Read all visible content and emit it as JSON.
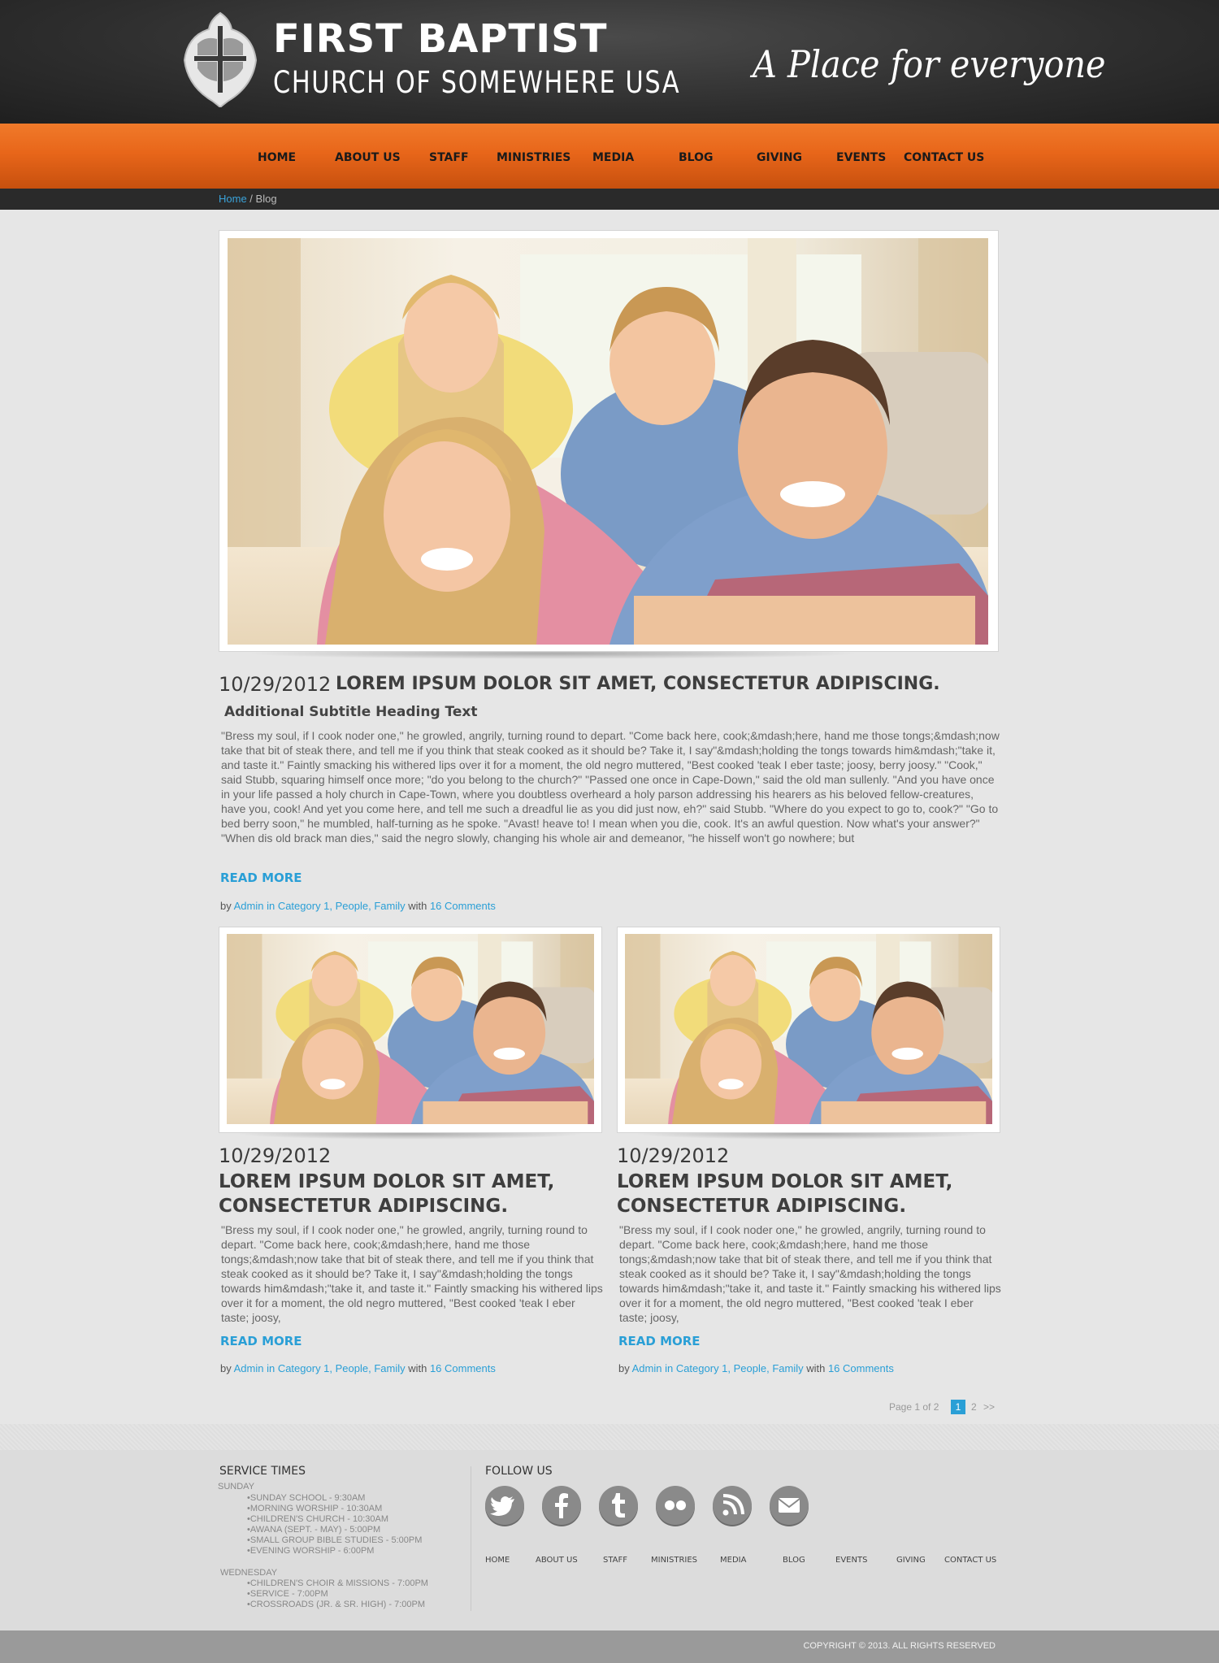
{
  "header": {
    "brand_line1": "FIRST BAPTIST",
    "brand_line2": "CHURCH OF SOMEWHERE USA",
    "tagline": "A Place for everyone",
    "logo_icon": "cross-shield-logo"
  },
  "nav": {
    "items": [
      "HOME",
      "ABOUT US",
      "STAFF",
      "MINISTRIES",
      "MEDIA",
      "BLOG",
      "GIVING",
      "EVENTS",
      "CONTACT US"
    ]
  },
  "breadcrumb": {
    "home": "Home",
    "separator": " / ",
    "current": "Blog"
  },
  "featured": {
    "image_alt": "Smiling family of four lying on floor",
    "date": "10/29/2012",
    "title": "LOREM IPSUM DOLOR SIT AMET, CONSECTETUR ADIPISCING.",
    "subtitle": "Additional Subtitle Heading Text",
    "excerpt": "\"Bress my soul, if I cook noder one,\" he growled, angrily, turning round to depart. \"Come back here, cook;&mdash;here, hand me those tongs;&mdash;now take that bit of steak there, and tell me if you think that steak cooked as it should be? Take it, I say\"&mdash;holding the tongs towards him&mdash;\"take it, and taste it.\" Faintly smacking his withered lips over it for a moment, the old negro muttered, \"Best cooked 'teak I eber taste; joosy, berry joosy.\" \"Cook,\" said Stubb, squaring himself once more; \"do you belong to the church?\" \"Passed one once in Cape-Down,\" said the old man sullenly. \"And you have once in your life passed a holy church in Cape-Town, where you doubtless overheard a holy parson addressing his hearers as his beloved fellow-creatures, have you, cook! And yet you come here, and tell me such a dreadful lie as you did just now, eh?\" said Stubb. \"Where do you expect to go to, cook?\" \"Go to bed berry soon,\" he mumbled, half-turning as he spoke. \"Avast! heave to! I mean when you die, cook. It's an awful question. Now what's your answer?\" \"When dis old brack man dies,\" said the negro slowly, changing his whole air and demeanor, \"he hisself won't go nowhere; but",
    "read_more": "READ MORE",
    "meta_by": "by ",
    "meta_author_cat": "Admin in Category 1, People, Family",
    "meta_with": " with ",
    "meta_comments": "16 Comments"
  },
  "posts": [
    {
      "date": "10/29/2012",
      "title_line1": "LOREM IPSUM DOLOR SIT AMET,",
      "title_line2": "CONSECTETUR ADIPISCING.",
      "excerpt": "\"Bress my soul, if I cook noder one,\" he growled, angrily, turning round to depart. \"Come back here, cook;&mdash;here, hand me those tongs;&mdash;now take that bit of steak there, and tell me if you think that steak cooked as it should be? Take it, I say\"&mdash;holding the tongs towards him&mdash;\"take it, and taste it.\" Faintly smacking his withered lips over it for a moment, the old negro muttered, \"Best cooked 'teak I eber taste; joosy,",
      "read_more": "READ MORE",
      "meta_by": "by ",
      "meta_author_cat": "Admin in Category 1, People, Family",
      "meta_with": " with ",
      "meta_comments": "16 Comments"
    },
    {
      "date": "10/29/2012",
      "title_line1": "LOREM IPSUM DOLOR SIT AMET,",
      "title_line2": "CONSECTETUR ADIPISCING.",
      "excerpt": "\"Bress my soul, if I cook noder one,\" he growled, angrily, turning round to depart. \"Come back here, cook;&mdash;here, hand me those tongs;&mdash;now take that bit of steak there, and tell me if you think that steak cooked as it should be? Take it, I say\"&mdash;holding the tongs towards him&mdash;\"take it, and taste it.\" Faintly smacking his withered lips over it for a moment, the old negro muttered, \"Best cooked 'teak I eber taste; joosy,",
      "read_more": "READ MORE",
      "meta_by": "by ",
      "meta_author_cat": "Admin in Category 1, People, Family",
      "meta_with": " with ",
      "meta_comments": "16 Comments"
    }
  ],
  "pagination": {
    "label": "Page 1 of 2",
    "current": "1",
    "next_page": "2",
    "next": ">>"
  },
  "footer": {
    "service_heading": "SERVICE TIMES",
    "sunday_label": "SUNDAY",
    "sunday_items": [
      "•SUNDAY SCHOOL - 9:30AM",
      "•MORNING WORSHIP - 10:30AM",
      "•CHILDREN'S CHURCH - 10:30AM",
      "•AWANA (SEPT. - MAY)  - 5:00PM",
      "•SMALL GROUP BIBLE STUDIES -  5:00PM",
      "•EVENING WORSHIP - 6:00PM"
    ],
    "wednesday_label": "WEDNESDAY",
    "wednesday_items": [
      "•CHILDREN'S CHOIR & MISSIONS - 7:00PM",
      "•SERVICE   - 7:00PM",
      "•CROSSROADS (JR. & SR. HIGH) - 7:00PM"
    ],
    "follow_heading": "FOLLOW US",
    "social_icons": [
      "twitter-icon",
      "facebook-icon",
      "tumblr-icon",
      "flickr-icon",
      "rss-icon",
      "email-icon"
    ],
    "nav_items": [
      "HOME",
      "ABOUT US",
      "STAFF",
      "MINISTRIES",
      "MEDIA",
      "BLOG",
      "EVENTS",
      "GIVING",
      "CONTACT US"
    ],
    "copyright": "COPYRIGHT © 2013. ALL RIGHTS RESERVED"
  },
  "colors": {
    "accent_blue": "#2a9fd6",
    "nav_orange": "#e8661a",
    "header_dark": "#2e2e2e"
  }
}
